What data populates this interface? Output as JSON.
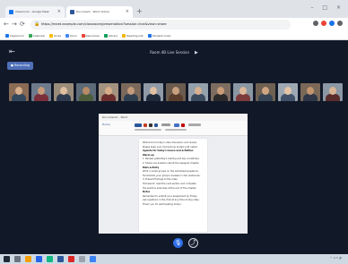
{
  "browser": {
    "tabs": [
      {
        "label": "Classroom - Google Meet",
        "favicon_color": "#1a73e8",
        "active": false
      },
      {
        "label": "Document - Word Online",
        "favicon_color": "#2b579a",
        "active": true
      }
    ],
    "new_tab_symbol": "+",
    "window_controls": "– □ ×",
    "url": "https://meet.example.com/classroom/presentation?session=live&view=share",
    "bookmarks": [
      {
        "label": "Classroom",
        "color": "#1a73e8"
      },
      {
        "label": "Calendar",
        "color": "#34a853"
      },
      {
        "label": "Drive",
        "color": "#fbbc05"
      },
      {
        "label": "Docs",
        "color": "#4285f4"
      },
      {
        "label": "Resources",
        "color": "#ea4335"
      },
      {
        "label": "Library",
        "color": "#0f9d58"
      },
      {
        "label": "Reading List",
        "color": "#f4b400"
      },
      {
        "label": "Student Links",
        "color": "#1a73e8"
      }
    ],
    "extension_colors": [
      "#5f6368",
      "#ea4335",
      "#1a73e8",
      "#5f6368"
    ]
  },
  "meeting": {
    "title": "Room 4B Live Session",
    "record_badge": "● Recording",
    "participant_tiles": [
      {
        "bg": "#8a6b55",
        "skin": "#d9b08c",
        "shirt": "#34495e"
      },
      {
        "bg": "#6e7b8c",
        "skin": "#c69c7a",
        "shirt": "#7a2f3a"
      },
      {
        "bg": "#9a8c7a",
        "skin": "#e0bfa0",
        "shirt": "#2e3a4f"
      },
      {
        "bg": "#5d6a78",
        "skin": "#b88a66",
        "shirt": "#4b5d3a"
      },
      {
        "bg": "#a39280",
        "skin": "#d8ae8a",
        "shirt": "#6b2d2d"
      },
      {
        "bg": "#7b6a5c",
        "skin": "#c59b7b",
        "shirt": "#2c3e50"
      },
      {
        "bg": "#8f9aa6",
        "skin": "#e2c0a2",
        "shirt": "#1f2b3a"
      },
      {
        "bg": "#6b5b4e",
        "skin": "#c8a07e",
        "shirt": "#5a3e2b"
      },
      {
        "bg": "#94a0ab",
        "skin": "#d6b090",
        "shirt": "#3b4b5e"
      },
      {
        "bg": "#7d6d60",
        "skin": "#c99b78",
        "shirt": "#2a2a2a"
      },
      {
        "bg": "#8b96a3",
        "skin": "#deb999",
        "shirt": "#7c3a3a"
      },
      {
        "bg": "#6f6152",
        "skin": "#cfa584",
        "shirt": "#354555"
      },
      {
        "bg": "#9ea8b3",
        "skin": "#e4c4a6",
        "shirt": "#42516a"
      },
      {
        "bg": "#7a6858",
        "skin": "#c49670",
        "shirt": "#2d3748"
      },
      {
        "bg": "#8c98a4",
        "skin": "#dab594",
        "shirt": "#5b2c2c"
      }
    ]
  },
  "shared_document": {
    "window_title": "Document1 - Word",
    "ribbon_label": "Home",
    "lines": [
      {
        "text": "Welcome to today's class discussion and review.",
        "heading": false
      },
      {
        "text": "Please keep your microphone muted until called.",
        "heading": false
      },
      {
        "text": "Agenda for today's lesson and activities",
        "heading": true
      },
      {
        "text": "Warm-up",
        "heading": true
      },
      {
        "text": "1. Review yesterday's reading and key vocabulary.",
        "heading": false
      },
      {
        "text": "2. Share one question about the assigned chapter.",
        "heading": false
      },
      {
        "text": "Main activity",
        "heading": true
      },
      {
        "text": "Work in small groups on the worksheet questions.",
        "heading": false
      },
      {
        "text": "Summarize your group's answers in two sentences.",
        "heading": false
      },
      {
        "text": "3. Present findings to the class.",
        "heading": false
      },
      {
        "text": "Homework: read the next section and complete",
        "heading": false
      },
      {
        "text": "the practice exercises at the end of the chapter.",
        "heading": false
      },
      {
        "text": "Notes",
        "heading": true
      },
      {
        "text": "Remember to submit your assignment by Friday.",
        "heading": false
      },
      {
        "text": "Ask questions in the chat at any time during class.",
        "heading": false
      },
      {
        "text": "Thank you for participating today!",
        "heading": false
      }
    ]
  },
  "controls": {
    "mic_icon": "mic-icon",
    "share_icon": "present-icon"
  },
  "taskbar": {
    "icon_colors": [
      "#1f2937",
      "#6b7280",
      "#f59e0b",
      "#2563eb",
      "#10b981",
      "#2b579a",
      "#dc2626",
      "#9ca3af",
      "#3b82f6"
    ],
    "tray_text": "^ ◁ ▭ 🔊"
  }
}
